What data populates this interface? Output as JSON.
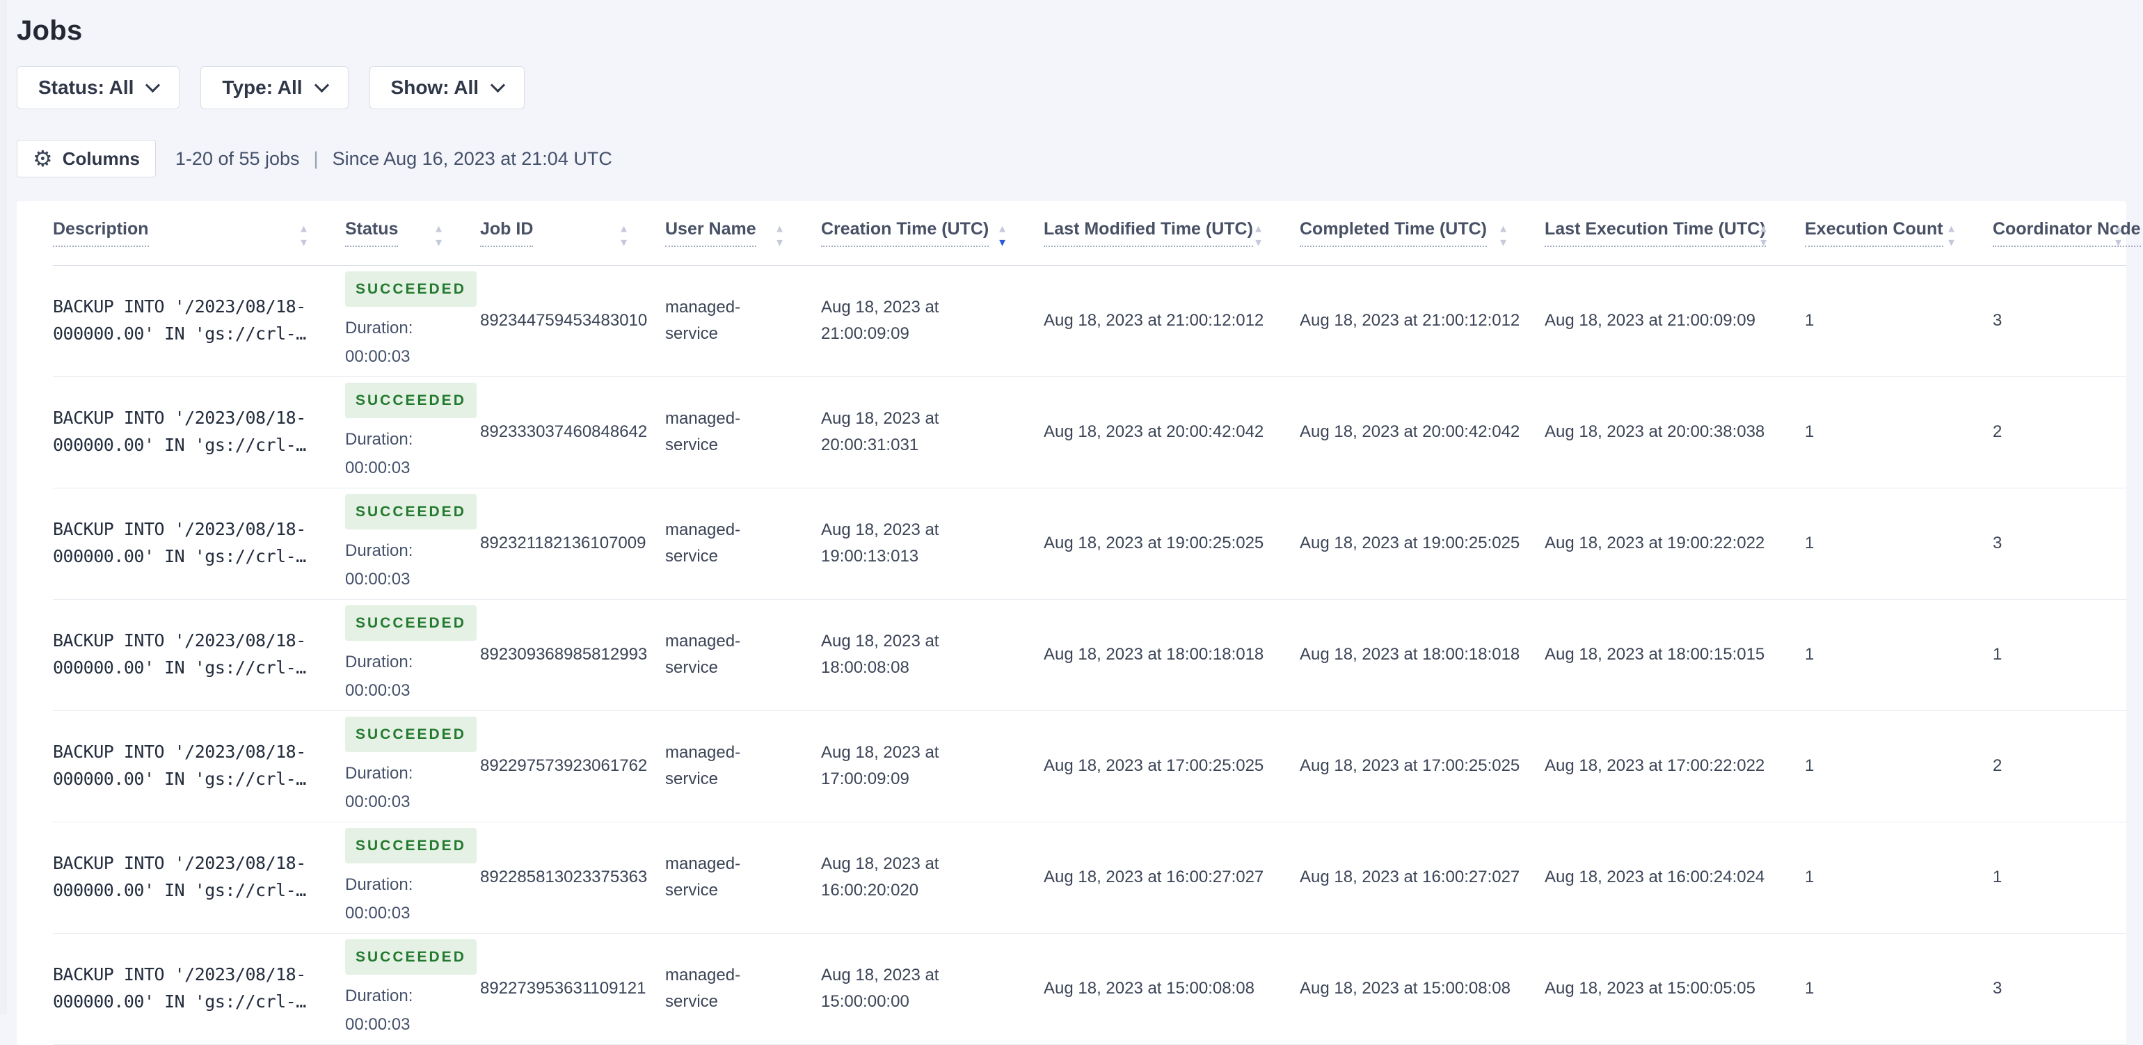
{
  "page_title": "Jobs",
  "filters": {
    "status": "Status: All",
    "type": "Type: All",
    "show": "Show: All"
  },
  "toolbar": {
    "columns_label": "Columns",
    "results_count": "1-20 of 55 jobs",
    "separator": "|",
    "since": "Since Aug 16, 2023 at 21:04 UTC"
  },
  "table": {
    "duration_label": "Duration:",
    "columns": [
      {
        "label": "Description",
        "sorted": ""
      },
      {
        "label": "Status",
        "sorted": ""
      },
      {
        "label": "Job ID",
        "sorted": ""
      },
      {
        "label": "User Name",
        "sorted": ""
      },
      {
        "label": "Creation Time (UTC)",
        "sorted": "desc"
      },
      {
        "label": "Last Modified Time (UTC)",
        "sorted": ""
      },
      {
        "label": "Completed Time (UTC)",
        "sorted": ""
      },
      {
        "label": "Last Execution Time (UTC)",
        "sorted": ""
      },
      {
        "label": "Execution Count",
        "sorted": ""
      },
      {
        "label": "Coordinator Node",
        "sorted": ""
      }
    ],
    "rows": [
      {
        "description": "BACKUP INTO '/2023/08/18-000000.00' IN 'gs://crl-…",
        "status": "SUCCEEDED",
        "duration": "00:00:03",
        "job_id": "892344759453483010",
        "user_name": "managed-service",
        "creation_time": "Aug 18, 2023 at 21:00:09:09",
        "last_modified_time": "Aug 18, 2023 at 21:00:12:012",
        "completed_time": "Aug 18, 2023 at 21:00:12:012",
        "last_execution_time": "Aug 18, 2023 at 21:00:09:09",
        "execution_count": "1",
        "coordinator_node": "3"
      },
      {
        "description": "BACKUP INTO '/2023/08/18-000000.00' IN 'gs://crl-…",
        "status": "SUCCEEDED",
        "duration": "00:00:03",
        "job_id": "892333037460848642",
        "user_name": "managed-service",
        "creation_time": "Aug 18, 2023 at 20:00:31:031",
        "last_modified_time": "Aug 18, 2023 at 20:00:42:042",
        "completed_time": "Aug 18, 2023 at 20:00:42:042",
        "last_execution_time": "Aug 18, 2023 at 20:00:38:038",
        "execution_count": "1",
        "coordinator_node": "2"
      },
      {
        "description": "BACKUP INTO '/2023/08/18-000000.00' IN 'gs://crl-…",
        "status": "SUCCEEDED",
        "duration": "00:00:03",
        "job_id": "892321182136107009",
        "user_name": "managed-service",
        "creation_time": "Aug 18, 2023 at 19:00:13:013",
        "last_modified_time": "Aug 18, 2023 at 19:00:25:025",
        "completed_time": "Aug 18, 2023 at 19:00:25:025",
        "last_execution_time": "Aug 18, 2023 at 19:00:22:022",
        "execution_count": "1",
        "coordinator_node": "3"
      },
      {
        "description": "BACKUP INTO '/2023/08/18-000000.00' IN 'gs://crl-…",
        "status": "SUCCEEDED",
        "duration": "00:00:03",
        "job_id": "892309368985812993",
        "user_name": "managed-service",
        "creation_time": "Aug 18, 2023 at 18:00:08:08",
        "last_modified_time": "Aug 18, 2023 at 18:00:18:018",
        "completed_time": "Aug 18, 2023 at 18:00:18:018",
        "last_execution_time": "Aug 18, 2023 at 18:00:15:015",
        "execution_count": "1",
        "coordinator_node": "1"
      },
      {
        "description": "BACKUP INTO '/2023/08/18-000000.00' IN 'gs://crl-…",
        "status": "SUCCEEDED",
        "duration": "00:00:03",
        "job_id": "892297573923061762",
        "user_name": "managed-service",
        "creation_time": "Aug 18, 2023 at 17:00:09:09",
        "last_modified_time": "Aug 18, 2023 at 17:00:25:025",
        "completed_time": "Aug 18, 2023 at 17:00:25:025",
        "last_execution_time": "Aug 18, 2023 at 17:00:22:022",
        "execution_count": "1",
        "coordinator_node": "2"
      },
      {
        "description": "BACKUP INTO '/2023/08/18-000000.00' IN 'gs://crl-…",
        "status": "SUCCEEDED",
        "duration": "00:00:03",
        "job_id": "892285813023375363",
        "user_name": "managed-service",
        "creation_time": "Aug 18, 2023 at 16:00:20:020",
        "last_modified_time": "Aug 18, 2023 at 16:00:27:027",
        "completed_time": "Aug 18, 2023 at 16:00:27:027",
        "last_execution_time": "Aug 18, 2023 at 16:00:24:024",
        "execution_count": "1",
        "coordinator_node": "1"
      },
      {
        "description": "BACKUP INTO '/2023/08/18-000000.00' IN 'gs://crl-…",
        "status": "SUCCEEDED",
        "duration": "00:00:03",
        "job_id": "892273953631109121",
        "user_name": "managed-service",
        "creation_time": "Aug 18, 2023 at 15:00:00:00",
        "last_modified_time": "Aug 18, 2023 at 15:00:08:08",
        "completed_time": "Aug 18, 2023 at 15:00:08:08",
        "last_execution_time": "Aug 18, 2023 at 15:00:05:05",
        "execution_count": "1",
        "coordinator_node": "3"
      }
    ]
  },
  "colors": {
    "page_background": "#F4F5FA",
    "card_background": "#FFFFFF",
    "badge_success_bg": "#E4F1E4",
    "badge_success_text": "#237A2F",
    "sort_active_blue": "#2B59D8",
    "text_primary": "#232834",
    "text_secondary": "#475064"
  }
}
